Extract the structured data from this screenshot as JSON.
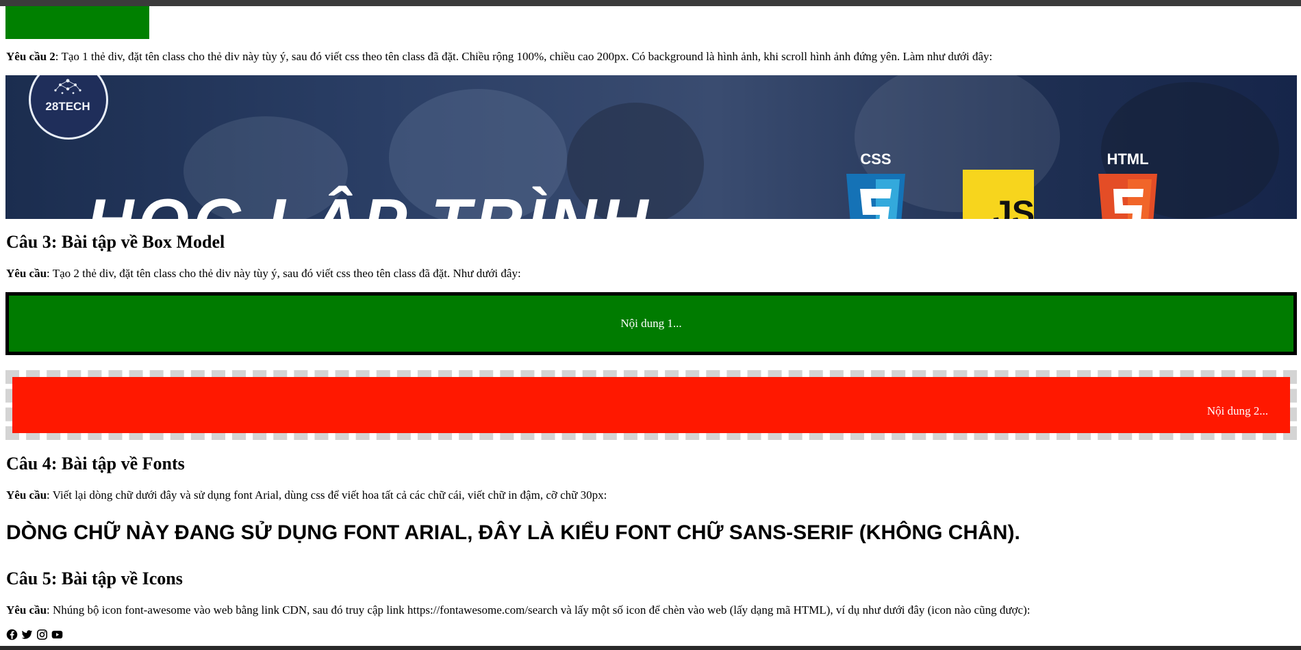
{
  "top": {
    "req2_label": "Yêu cầu 2",
    "req2_text": ": Tạo 1 thẻ div, đặt tên class cho thẻ div này tùy ý, sau đó viết css theo tên class đã đặt. Chiều rộng 100%, chiều cao 200px. Có background là hình ảnh, khi scroll hình ảnh đứng yên. Làm như dưới đây:"
  },
  "banner": {
    "logo_text": "28TECH",
    "big_text": "HỌC LẬP TRÌNH",
    "css_label": "CSS",
    "js_label": "JS",
    "html_label": "HTML"
  },
  "section3": {
    "heading": "Câu 3: Bài tập về Box Model",
    "req_label": "Yêu cầu",
    "req_text": ": Tạo 2 thẻ div, đặt tên class cho thẻ div này tùy ý, sau đó viết css theo tên class đã đặt. Như dưới đây:",
    "box1_text": "Nội dung 1...",
    "box2_text": "Nội dung 2..."
  },
  "section4": {
    "heading": "Câu 4: Bài tập về Fonts",
    "req_label": "Yêu cầu",
    "req_text": ": Viết lại dòng chữ dưới đây và sử dụng font Arial, dùng css để viết hoa tất cả các chữ cái, viết chữ in đậm, cỡ chữ 30px:",
    "sample": "DÒNG CHỮ NÀY ĐANG SỬ DỤNG FONT ARIAL, ĐÂY LÀ KIỂU FONT CHỮ SANS-SERIF (KHÔNG CHÂN)."
  },
  "section5": {
    "heading": "Câu 5: Bài tập về Icons",
    "req_label": "Yêu cầu",
    "req_text": ": Nhúng bộ icon font-awesome vào web bằng link CDN, sau đó truy cập link https://fontawesome.com/search và lấy một số icon để chèn vào web (lấy dạng mã HTML), ví dụ như dưới đây (icon nào cũng được):",
    "icons": [
      "facebook-icon",
      "twitter-icon",
      "instagram-icon",
      "youtube-icon"
    ]
  },
  "colors": {
    "green": "#008000",
    "red": "#ff1800",
    "dashed_border": "#d4d4d4",
    "banner_bg": "#1e2f52"
  }
}
